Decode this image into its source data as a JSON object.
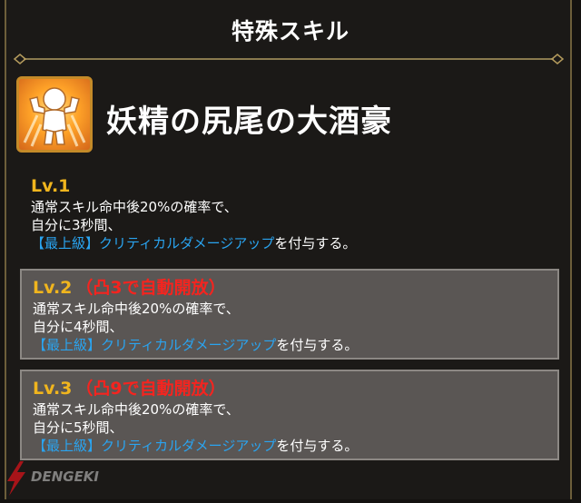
{
  "header": {
    "title": "特殊スキル"
  },
  "skill": {
    "name": "妖精の尻尾の大酒豪",
    "icon": "flexing-character-icon"
  },
  "levels": [
    {
      "label": "Lv.1",
      "unlock": "",
      "line1": "通常スキル命中後20%の確率で、",
      "line2": "自分に3秒間、",
      "highlight": "【最上級】クリティカルダメージアップ",
      "tail": "を付与する。"
    },
    {
      "label": "Lv.2",
      "unlock": "（凸3で自動開放）",
      "line1": "通常スキル命中後20%の確率で、",
      "line2": "自分に4秒間、",
      "highlight": "【最上級】クリティカルダメージアップ",
      "tail": "を付与する。"
    },
    {
      "label": "Lv.3",
      "unlock": "（凸9で自動開放）",
      "line1": "通常スキル命中後20%の確率で、",
      "line2": "自分に5秒間、",
      "highlight": "【最上級】クリティカルダメージアップ",
      "tail": "を付与する。"
    }
  ],
  "watermark": {
    "text": "DENGEKI"
  },
  "colors": {
    "gold": "#f0b51e",
    "red": "#f5241f",
    "blue": "#2aa4f0"
  }
}
